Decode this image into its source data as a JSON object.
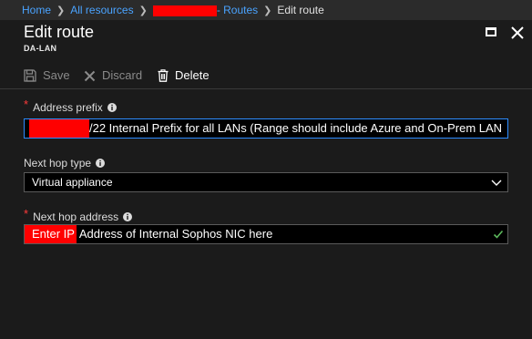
{
  "breadcrumb": {
    "home": "Home",
    "all_resources": "All resources",
    "routes_suffix": "- Routes",
    "current": "Edit route"
  },
  "header": {
    "title": "Edit route",
    "subtitle": "DA-LAN"
  },
  "toolbar": {
    "save": "Save",
    "discard": "Discard",
    "delete": "Delete"
  },
  "form": {
    "address_prefix": {
      "label": "Address prefix",
      "value_suffix": "/22   Internal Prefix for all LANs (Range should include Azure and On-Prem LAN"
    },
    "next_hop_type": {
      "label": "Next hop type",
      "selected": "Virtual appliance"
    },
    "next_hop_address": {
      "label": "Next hop address",
      "highlight": "Enter IP",
      "value_rest": " Address of Internal Sophos NIC here"
    }
  },
  "colors": {
    "accent": "#2d8cff",
    "link": "#4aa3ff",
    "required": "#ff3b3b",
    "redaction": "#ff0000",
    "valid": "#5cb85c"
  },
  "icons": [
    "info-icon",
    "check-icon",
    "chevron-down-icon",
    "save-icon",
    "discard-icon",
    "delete-icon",
    "maximize-icon",
    "close-icon"
  ]
}
